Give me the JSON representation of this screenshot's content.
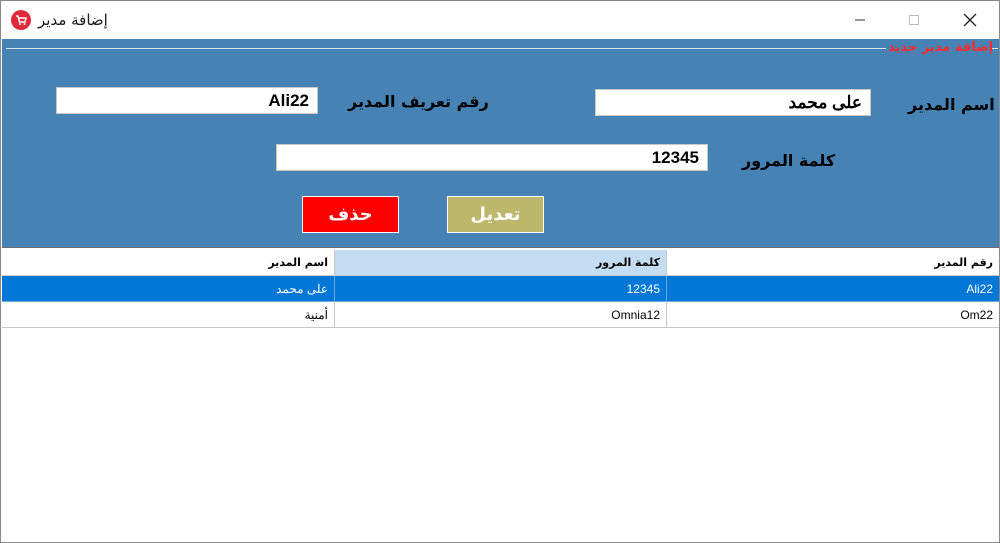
{
  "window": {
    "title": "إضافة مدير",
    "icon": "cart-icon",
    "accent_color": "#e0283a"
  },
  "panel": {
    "background": "#4682b4",
    "group_title": "إضافة مدير جديد",
    "manager_id_label": "رقم تعريف المدير",
    "manager_id_value": "Ali22",
    "manager_name_label": "اسم المدير",
    "manager_name_value": "على محمد",
    "password_label": "كلمة المرور",
    "password_value": "12345",
    "delete_label": "حذف",
    "edit_label": "تعديل",
    "delete_color": "#ff0000",
    "edit_color": "#bdb76b"
  },
  "grid": {
    "columns": [
      "اسم المدير",
      "كلمة المرور",
      "رقم المدير"
    ],
    "rows": [
      {
        "name": "على محمد",
        "password": "12345",
        "id": "Ali22"
      },
      {
        "name": "أمنية",
        "password": "Omnia12",
        "id": "Om22"
      }
    ],
    "selection_color": "#0078d7"
  }
}
